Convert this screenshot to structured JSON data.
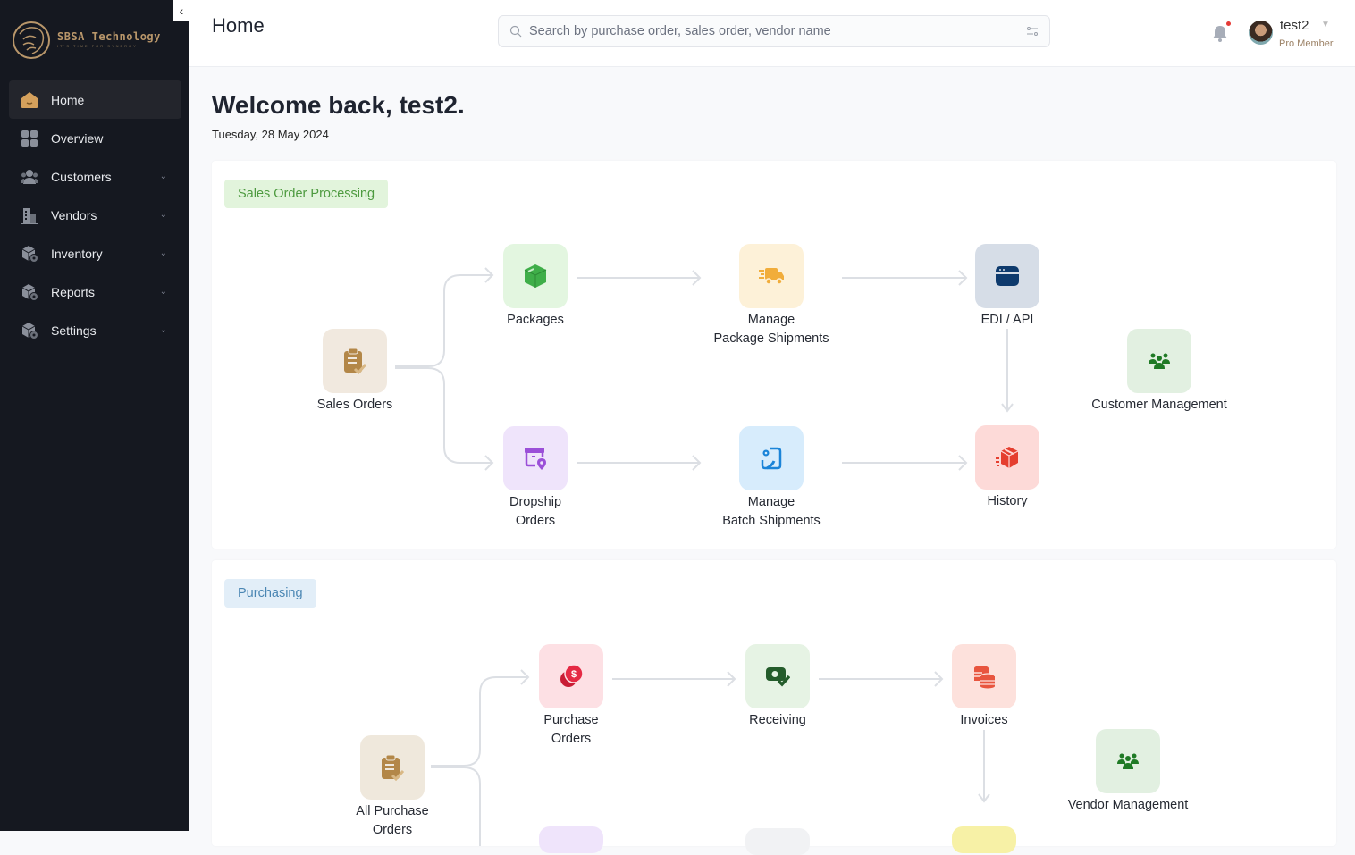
{
  "brand": {
    "name": "SBSA Technology",
    "tagline": "IT'S TIME FOR SYNERGY"
  },
  "sidebar": {
    "items": [
      {
        "label": "Home",
        "icon": "home-icon",
        "active": true
      },
      {
        "label": "Overview",
        "icon": "grid-icon"
      },
      {
        "label": "Customers",
        "icon": "users-icon",
        "expandable": true
      },
      {
        "label": "Vendors",
        "icon": "building-icon",
        "expandable": true
      },
      {
        "label": "Inventory",
        "icon": "box-gear-icon",
        "expandable": true
      },
      {
        "label": "Reports",
        "icon": "box-gear-icon",
        "expandable": true
      },
      {
        "label": "Settings",
        "icon": "box-gear-icon",
        "expandable": true
      }
    ]
  },
  "header": {
    "title": "Home",
    "search_placeholder": "Search by purchase order, sales order, vendor name",
    "user": {
      "name": "test2",
      "role": "Pro Member"
    }
  },
  "welcome": {
    "greeting": "Welcome back, test2.",
    "date": "Tuesday, 28 May 2024"
  },
  "sales": {
    "title": "Sales Order Processing",
    "nodes": {
      "sales_orders": "Sales Orders",
      "packages": "Packages",
      "manage_pkg_1": "Manage",
      "manage_pkg_2": "Package Shipments",
      "edi_api": "EDI / API",
      "customer_mgmt": "Customer Management",
      "dropship_1": "Dropship",
      "dropship_2": "Orders",
      "batch_1": "Manage",
      "batch_2": "Batch Shipments",
      "history": "History"
    }
  },
  "purchasing": {
    "title": "Purchasing",
    "nodes": {
      "all_po_1": "All Purchase",
      "all_po_2": "Orders",
      "po_1": "Purchase",
      "po_2": "Orders",
      "receiving": "Receiving",
      "invoices": "Invoices",
      "vendor_mgmt": "Vendor Management"
    }
  },
  "colors": {
    "accent": "#b8966a",
    "sidebar_bg": "#151820"
  }
}
